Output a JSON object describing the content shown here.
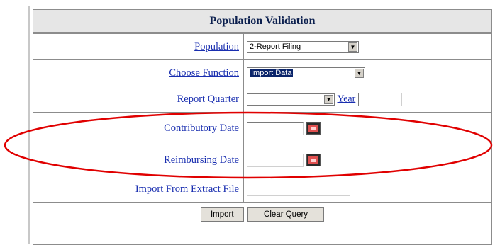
{
  "title": "Population Validation",
  "rows": {
    "population": {
      "label": "Population",
      "value": "2-Report Filing"
    },
    "choose_function": {
      "label": "Choose Function",
      "value": "Import Data"
    },
    "report_quarter": {
      "label": "Report Quarter",
      "value": "",
      "year_label": "Year",
      "year_value": ""
    },
    "contributory_date": {
      "label": "Contributory Date",
      "value": ""
    },
    "reimbursing_date": {
      "label": "Reimbursing Date",
      "value": ""
    },
    "import_file": {
      "label": "Import From Extract File",
      "value": ""
    }
  },
  "buttons": {
    "import": "Import",
    "clear": "Clear Query"
  },
  "colors": {
    "link": "#1a2fb0",
    "header_text": "#0b1f4e",
    "highlight": "#0a246a",
    "annotation": "#e00000"
  }
}
